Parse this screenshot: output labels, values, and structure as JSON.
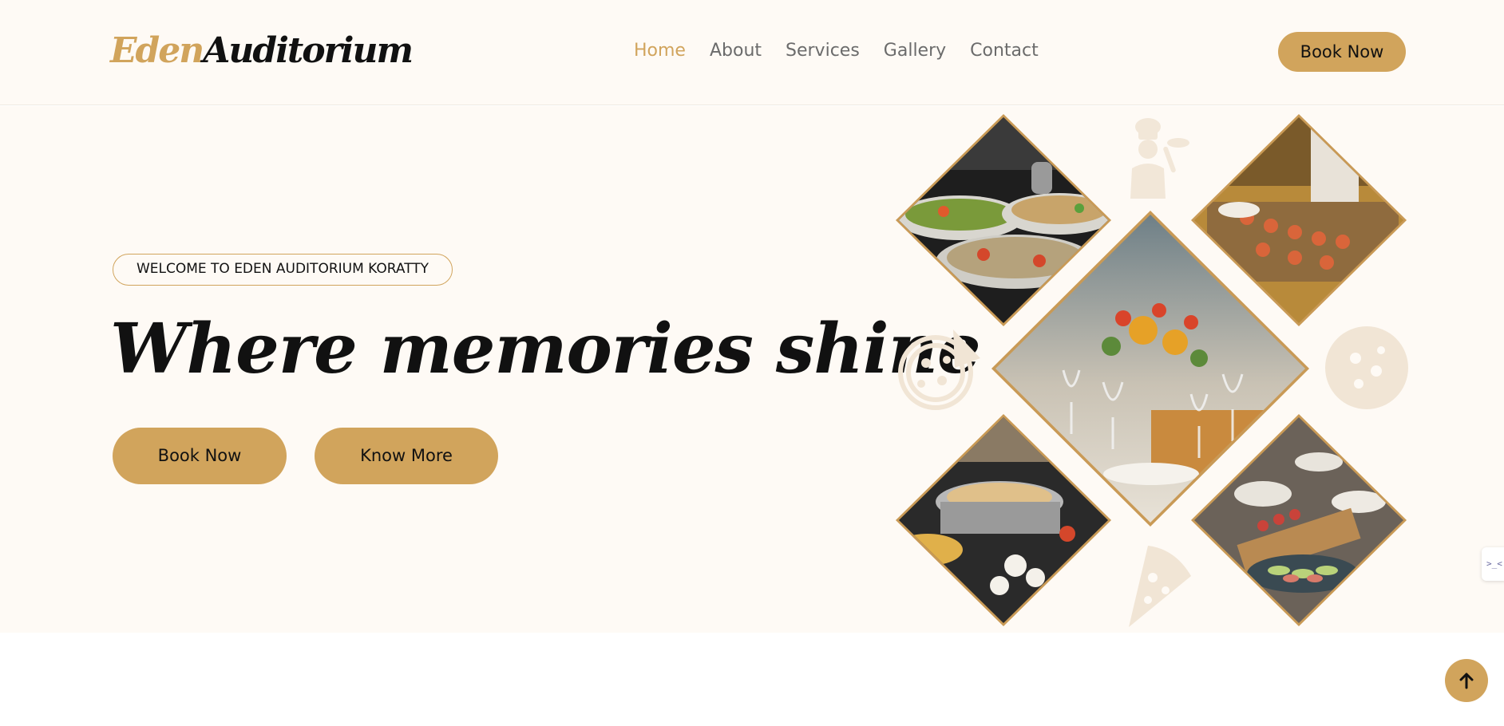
{
  "brand": {
    "part1": "Eden",
    "part2": "Auditorium"
  },
  "nav": {
    "items": [
      {
        "label": "Home",
        "active": true
      },
      {
        "label": "About",
        "active": false
      },
      {
        "label": "Services",
        "active": false
      },
      {
        "label": "Gallery",
        "active": false
      },
      {
        "label": "Contact",
        "active": false
      }
    ],
    "book_label": "Book Now"
  },
  "hero": {
    "badge": "WELCOME TO EDEN AUDITORIUM KORATTY",
    "headline": "Where memories shine",
    "primary_button": "Book Now",
    "secondary_button": "Know More"
  },
  "gallery": {
    "images": [
      {
        "name": "salad-buffet-photo"
      },
      {
        "name": "canapes-tray-photo"
      },
      {
        "name": "table-setting-flowers-photo"
      },
      {
        "name": "chafing-dishes-photo"
      },
      {
        "name": "charcuterie-table-photo"
      }
    ]
  },
  "side_tab": {
    "text": ">_<"
  },
  "colors": {
    "accent": "#d1a45c",
    "hero_background": "#fefaf5",
    "text": "#111111",
    "nav_text": "#6b6b6b"
  },
  "icons": {
    "back_to_top": "arrow-up-icon",
    "decor": [
      "chef-icon",
      "pizza-icon",
      "pizza-half-icon",
      "pizza-slice-icon"
    ]
  }
}
